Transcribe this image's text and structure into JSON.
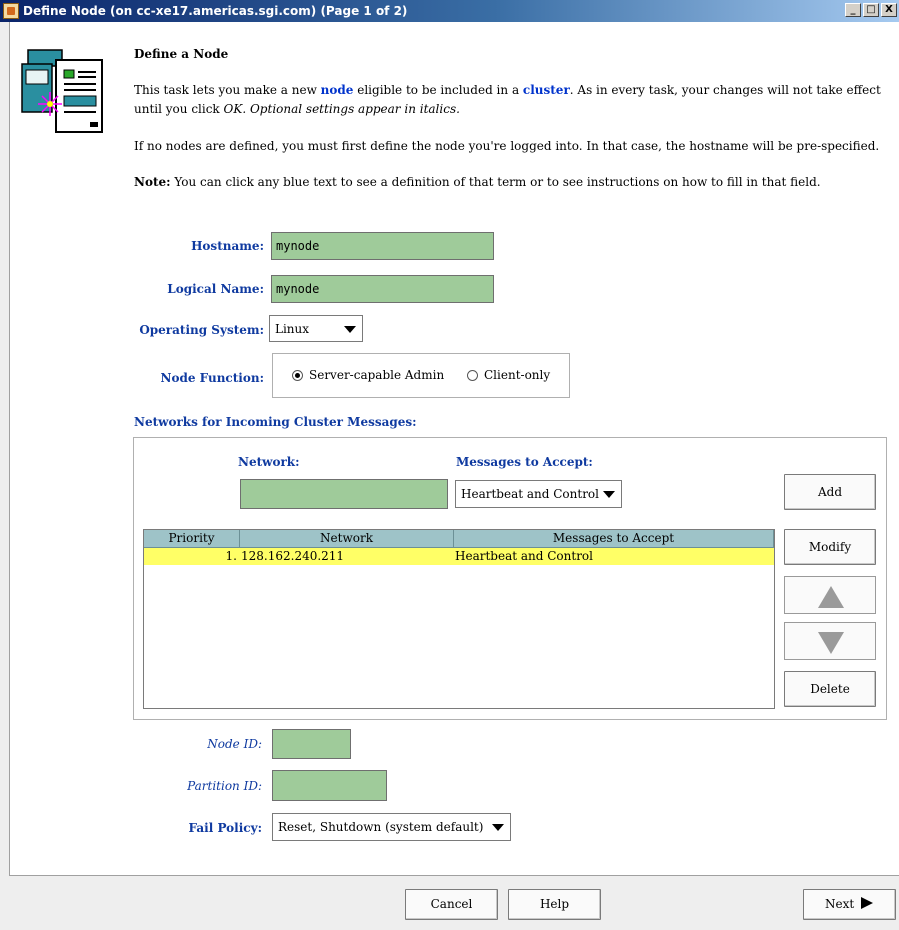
{
  "window": {
    "title": "Define Node (on cc-xe17.americas.sgi.com) (Page 1 of 2)",
    "minimize": "_",
    "maximize": "□",
    "close": "X"
  },
  "intro": {
    "heading": "Define a Node",
    "p1_a": "This task lets you make a new ",
    "p1_node": "node",
    "p1_b": " eligible to be included in a ",
    "p1_cluster": "cluster",
    "p1_c": ". As in every task, your changes will not take effect",
    "p1_d": "until you click ",
    "p1_ok": "OK.",
    "p1_e": " Optional settings appear in italics.",
    "p2": "If no nodes are defined, you must first define the node you're logged into.  In that case, the hostname will be pre-specified.",
    "note_label": "Note:",
    "note_text": " You can click any blue text to see a definition of that term or to see instructions on how to fill in that field."
  },
  "form": {
    "hostname_label": "Hostname:",
    "hostname_value": "mynode",
    "logical_label": "Logical Name:",
    "logical_value": "mynode",
    "os_label": "Operating System:",
    "os_value": "Linux",
    "function_label": "Node Function:",
    "function_opt1": "Server-capable Admin",
    "function_opt2": "Client-only",
    "function_selected": "Server-capable Admin",
    "networks_label": "Networks for Incoming Cluster Messages:",
    "network_label": "Network:",
    "network_value": "",
    "accept_label": "Messages to Accept:",
    "accept_value": "Heartbeat and Control",
    "node_id_label": "Node ID:",
    "node_id_value": "",
    "partition_label": "Partition ID:",
    "partition_value": "",
    "fail_label": "Fail Policy:",
    "fail_value": "Reset, Shutdown (system default)"
  },
  "networks_table": {
    "columns": [
      "Priority",
      "Network",
      "Messages to Accept"
    ],
    "rows": [
      {
        "priority": "1.",
        "network": "128.162.240.211",
        "accept": "Heartbeat and Control"
      }
    ]
  },
  "side_buttons": {
    "add": "Add",
    "modify": "Modify",
    "delete": "Delete"
  },
  "footer": {
    "cancel": "Cancel",
    "help": "Help",
    "next": "Next"
  },
  "colors": {
    "label_blue": "#0f3aa0",
    "field_green": "#9fcb9a",
    "row_highlight": "#ffff66",
    "header_teal": "#9ec3c8"
  }
}
